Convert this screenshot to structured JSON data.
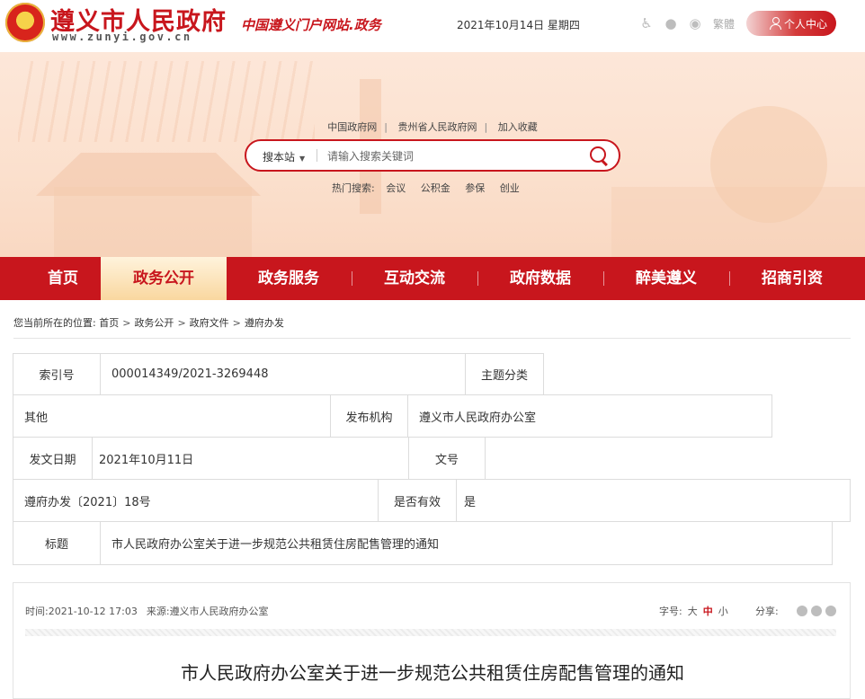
{
  "header": {
    "site_name": "遵义市人民政府",
    "site_url": "www.zunyi.gov.cn",
    "portal_subtitle": "中国遵义门户网站.政务",
    "date": "2021年10月14日  星期四",
    "accessibility_icons": [
      "wheelchair-icon",
      "wechat-icon",
      "weibo-icon"
    ],
    "traditional_label": "繁體",
    "user_center_label": "个人中心"
  },
  "banner": {
    "quick_links": [
      "中国政府网",
      "贵州省人民政府网",
      "加入收藏"
    ],
    "search": {
      "scope": "搜本站",
      "placeholder": "请输入搜索关键词"
    },
    "hot_search_label": "热门搜索:",
    "hot_search_terms": [
      "会议",
      "公积金",
      "参保",
      "创业"
    ]
  },
  "nav": {
    "items": [
      {
        "label": "首页"
      },
      {
        "label": "政务公开"
      },
      {
        "label": "政务服务"
      },
      {
        "label": "互动交流"
      },
      {
        "label": "政府数据"
      },
      {
        "label": "醉美遵义"
      },
      {
        "label": "招商引资"
      }
    ],
    "active_index": 1
  },
  "breadcrumb": {
    "prefix": "您当前所在的位置:",
    "items": [
      "首页",
      "政务公开",
      "政府文件",
      "遵府办发"
    ]
  },
  "info_table": {
    "index_label": "索引号",
    "index_value": "000014349/2021-3269448",
    "topic_label": "主题分类",
    "topic_value": "其他",
    "publisher_label": "发布机构",
    "publisher_value": "遵义市人民政府办公室",
    "issue_date_label": "发文日期",
    "issue_date_value": "2021年10月11日",
    "doc_no_label": "文号",
    "doc_no_value": "遵府办发〔2021〕18号",
    "valid_label": "是否有效",
    "valid_value": "是",
    "title_label": "标题",
    "title_value": "市人民政府办公室关于进一步规范公共租赁住房配售管理的通知"
  },
  "article": {
    "time_label": "时间:",
    "time_value": "2021-10-12 17:03",
    "source_label": "来源:",
    "source_value": "遵义市人民政府办公室",
    "font_size_label": "字号:",
    "font_sizes": [
      "大",
      "中",
      "小"
    ],
    "current_font_size": "中",
    "share_label": "分享:",
    "title": "市人民政府办公室关于进一步规范公共租赁住房配售管理的通知"
  },
  "colors": {
    "brand_red": "#c8161d",
    "nav_active_bg": "#f9d79f",
    "border": "#dcdcdc"
  }
}
